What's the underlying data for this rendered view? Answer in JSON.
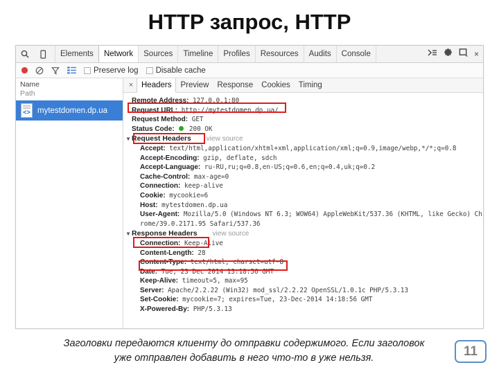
{
  "slide": {
    "title": "HTTP запрос, HTTP",
    "caption_line1": "Заголовки передаются клиенту до отправки содержимого. Если заголовок",
    "caption_line2": "уже отправлен добавить в него что-то в уже нельзя.",
    "page_number": "11",
    "badge_border_color": "#5b8fc9",
    "annotation_color": "#e01b1b"
  },
  "devtools": {
    "toolbar": {
      "icons": [
        "search-icon",
        "device-mode-icon"
      ],
      "tabs": [
        {
          "label": "Elements",
          "active": false
        },
        {
          "label": "Network",
          "active": true
        },
        {
          "label": "Sources",
          "active": false
        },
        {
          "label": "Timeline",
          "active": false
        },
        {
          "label": "Profiles",
          "active": false
        },
        {
          "label": "Resources",
          "active": false
        },
        {
          "label": "Audits",
          "active": false
        },
        {
          "label": "Console",
          "active": false
        }
      ],
      "right_icons": [
        "console-drawer-icon",
        "gear-icon",
        "dock-side-icon",
        "close-icon"
      ],
      "close_label": "×"
    },
    "filterbar": {
      "record_label": "record-button",
      "clear_label": "clear-button",
      "filter_label": "filter-button",
      "view_label": "view-list-button",
      "preserve_log": {
        "label": "Preserve log",
        "checked": false
      },
      "disable_cache": {
        "label": "Disable cache",
        "checked": false
      }
    },
    "request_list": {
      "col_name": "Name",
      "col_path": "Path",
      "rows": [
        {
          "name": "mytestdomen.dp.ua",
          "icon": "document-code-icon",
          "selected": true
        }
      ]
    },
    "detail_tabs": [
      {
        "label": "Headers",
        "active": true
      },
      {
        "label": "Preview",
        "active": false
      },
      {
        "label": "Response",
        "active": false
      },
      {
        "label": "Cookies",
        "active": false
      },
      {
        "label": "Timing",
        "active": false
      }
    ],
    "detail_close": "×",
    "general": [
      {
        "key": "Remote Address:",
        "value": "127.0.0.1:80"
      },
      {
        "key": "Request URL:",
        "value": "http://mytestdomen.dp.ua/"
      },
      {
        "key": "Request Method:",
        "value": "GET"
      },
      {
        "key": "Status Code:",
        "value": "200 OK",
        "has_status_dot": true
      }
    ],
    "request_headers": {
      "title": "Request Headers",
      "view_source": "view source",
      "triangle": "▼",
      "items": [
        {
          "key": "Accept:",
          "value": "text/html,application/xhtml+xml,application/xml;q=0.9,image/webp,*/*;q=0.8"
        },
        {
          "key": "Accept-Encoding:",
          "value": "gzip, deflate, sdch"
        },
        {
          "key": "Accept-Language:",
          "value": "ru-RU,ru;q=0.8,en-US;q=0.6,en;q=0.4,uk;q=0.2"
        },
        {
          "key": "Cache-Control:",
          "value": "max-age=0"
        },
        {
          "key": "Connection:",
          "value": "keep-alive"
        },
        {
          "key": "Cookie:",
          "value": "mycookie=6"
        },
        {
          "key": "Host:",
          "value": "mytestdomen.dp.ua"
        },
        {
          "key": "User-Agent:",
          "value": "Mozilla/5.0 (Windows NT 6.3; WOW64) AppleWebKit/537.36 (KHTML, like Gecko) Ch"
        },
        {
          "key": "",
          "value": "rome/39.0.2171.95 Safari/537.36"
        }
      ]
    },
    "response_headers": {
      "title": "Response Headers",
      "view_source": "view source",
      "triangle": "▼",
      "items": [
        {
          "key": "Connection:",
          "value": "Keep-Alive"
        },
        {
          "key": "Content-Length:",
          "value": "28"
        },
        {
          "key": "Content-Type:",
          "value": "text/html; charset=utf-8"
        },
        {
          "key": "Date:",
          "value": "Tue, 23 Dec 2014 13:18:56 GMT"
        },
        {
          "key": "Keep-Alive:",
          "value": "timeout=5, max=95"
        },
        {
          "key": "Server:",
          "value": "Apache/2.2.22 (Win32) mod_ssl/2.2.22 OpenSSL/1.0.1c PHP/5.3.13"
        },
        {
          "key": "Set-Cookie:",
          "value": "mycookie=7; expires=Tue, 23-Dec-2014 14:18:56 GMT"
        },
        {
          "key": "X-Powered-By:",
          "value": "PHP/5.3.13"
        }
      ]
    }
  }
}
